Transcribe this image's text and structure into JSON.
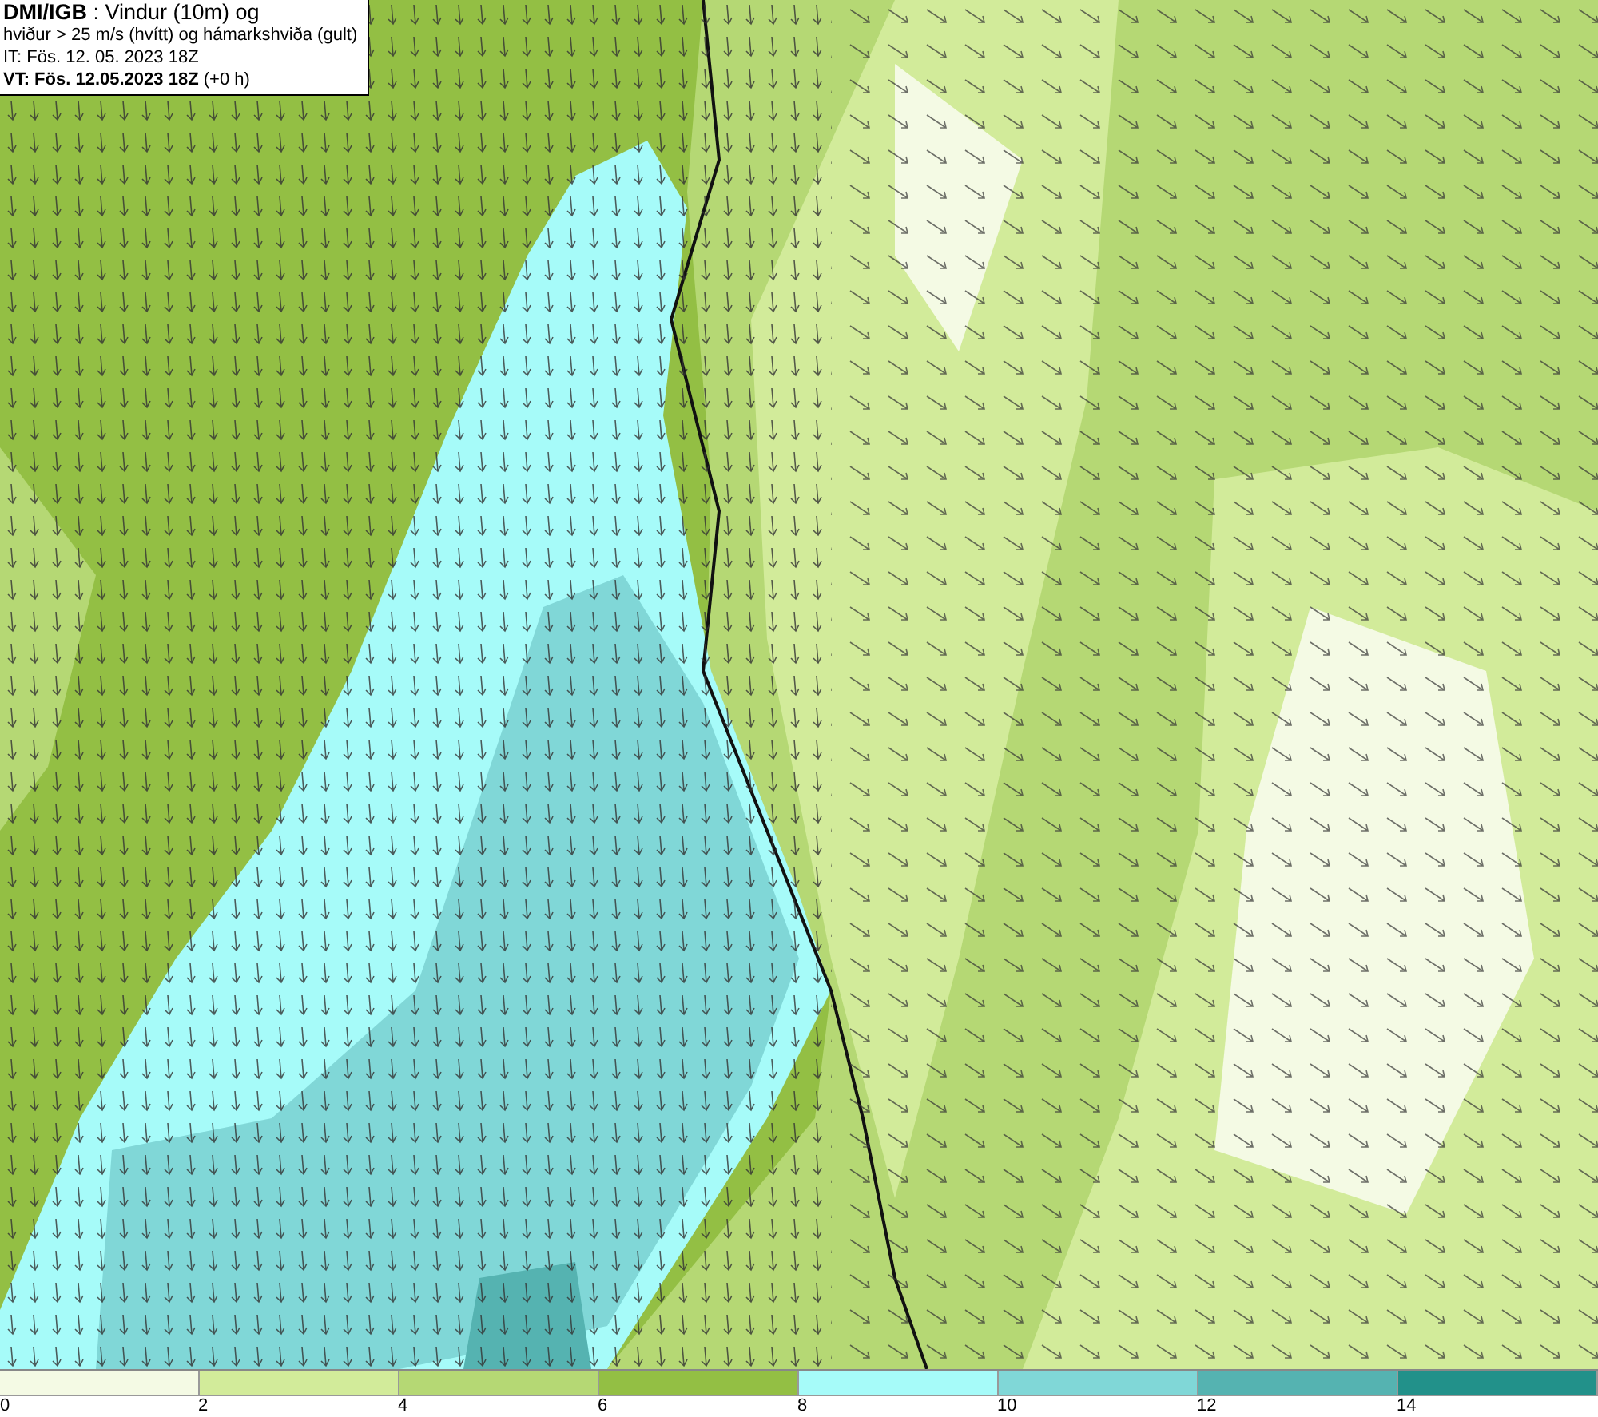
{
  "header": {
    "lines": [
      "**DMI/IGB** : Vindur (10m) og",
      "hviður > 25 m/s (hvítt) og hámarkshviða (gult)",
      "IT: Fös. 12. 05. 2023 18Z",
      "**VT: Fös. 12.05.2023 18Z** (+0 h)"
    ]
  },
  "legend": {
    "bins": [
      {
        "label": "0",
        "color": "#f4fae4"
      },
      {
        "label": "2",
        "color": "#d2eb9a"
      },
      {
        "label": "4",
        "color": "#b5d874"
      },
      {
        "label": "6",
        "color": "#93bf44"
      },
      {
        "label": "8",
        "color": "#a6fbf9"
      },
      {
        "label": "10",
        "color": "#80d7d7"
      },
      {
        "label": "12",
        "color": "#55b3b1"
      },
      {
        "label": "14",
        "color": "#22918a"
      }
    ]
  }
}
